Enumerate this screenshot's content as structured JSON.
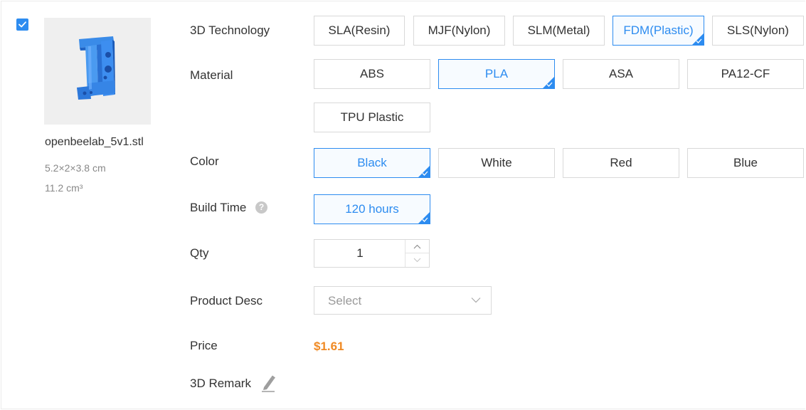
{
  "item": {
    "selected": true,
    "file_name": "openbeelab_5v1.stl",
    "dimensions": "5.2×2×3.8 cm",
    "volume": "11.2 cm³"
  },
  "labels": {
    "technology": "3D Technology",
    "material": "Material",
    "color": "Color",
    "build_time": "Build Time",
    "qty": "Qty",
    "product_desc": "Product Desc",
    "price": "Price",
    "remark": "3D Remark"
  },
  "technology": {
    "options": [
      "SLA(Resin)",
      "MJF(Nylon)",
      "SLM(Metal)",
      "FDM(Plastic)",
      "SLS(Nylon)"
    ],
    "selected": "FDM(Plastic)"
  },
  "material": {
    "options": [
      "ABS",
      "PLA",
      "ASA",
      "PA12-CF",
      "TPU Plastic"
    ],
    "selected": "PLA"
  },
  "color": {
    "options": [
      "Black",
      "White",
      "Red",
      "Blue"
    ],
    "selected": "Black"
  },
  "build_time": {
    "options": [
      "120 hours"
    ],
    "selected": "120 hours"
  },
  "qty": {
    "value": "1"
  },
  "product_desc": {
    "placeholder": "Select"
  },
  "price": {
    "value": "$1.61"
  },
  "icons": {
    "help": "question-circle-icon",
    "remark": "pencil-icon",
    "select": "chevron-down-icon",
    "qty_up": "chevron-up-icon",
    "qty_down": "chevron-down-icon"
  },
  "colors": {
    "accent": "#2d8cf0",
    "price": "#f08a24",
    "part_model": "#3c8ee8"
  }
}
